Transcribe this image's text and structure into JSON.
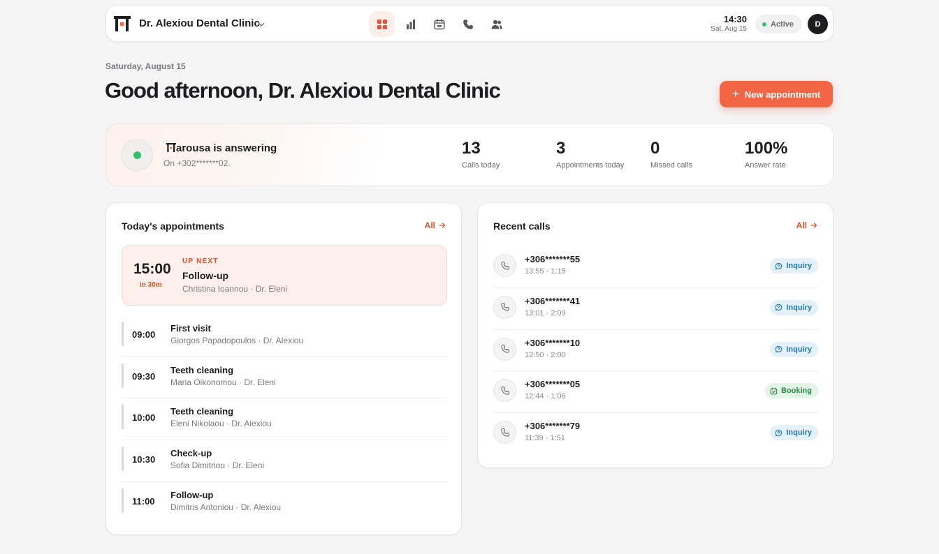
{
  "header": {
    "clinic_name": "Dr. Alexiou Dental Clinic",
    "nav": [
      {
        "name": "dashboard-icon",
        "active": true
      },
      {
        "name": "analytics-icon",
        "active": false
      },
      {
        "name": "calendar-icon",
        "active": false
      },
      {
        "name": "phone-icon",
        "active": false
      },
      {
        "name": "contacts-icon",
        "active": false
      }
    ],
    "time": "14:30",
    "date": "Sat, Aug 15",
    "status": "Active",
    "avatar_initial": "D"
  },
  "page": {
    "date_label": "Saturday, August 15",
    "greeting": "Good afternoon, Dr. Alexiou Dental Clinic",
    "new_appointment_label": "New appointment"
  },
  "assistant": {
    "name_suffix": "arousa is answering",
    "subtitle": "On +302*******02."
  },
  "stats": [
    {
      "value": "13",
      "label": "Calls today"
    },
    {
      "value": "3",
      "label": "Appointments today"
    },
    {
      "value": "0",
      "label": "Missed calls"
    },
    {
      "value": "100%",
      "label": "Answer rate"
    }
  ],
  "appointments": {
    "title": "Today's appointments",
    "all_label": "All",
    "next": {
      "time": "15:00",
      "in": "in 30m",
      "badge": "UP NEXT",
      "title": "Follow-up",
      "subtitle": "Christina Ioannou · Dr. Eleni"
    },
    "items": [
      {
        "time": "09:00",
        "title": "First visit",
        "subtitle": "Giorgos Papadopoulos · Dr. Alexiou"
      },
      {
        "time": "09:30",
        "title": "Teeth cleaning",
        "subtitle": "Maria Oikonomou · Dr. Eleni"
      },
      {
        "time": "10:00",
        "title": "Teeth cleaning",
        "subtitle": "Eleni Nikolaou · Dr. Alexiou"
      },
      {
        "time": "10:30",
        "title": "Check-up",
        "subtitle": "Sofia Dimitriou · Dr. Eleni"
      },
      {
        "time": "11:00",
        "title": "Follow-up",
        "subtitle": "Dimitris Antoniou · Dr. Alexiou"
      }
    ]
  },
  "calls": {
    "title": "Recent calls",
    "all_label": "All",
    "items": [
      {
        "number": "+306*******55",
        "meta": "13:55 · 1:15",
        "tag": "Inquiry",
        "kind": "inquiry"
      },
      {
        "number": "+306*******41",
        "meta": "13:01 · 2:09",
        "tag": "Inquiry",
        "kind": "inquiry"
      },
      {
        "number": "+306*******10",
        "meta": "12:50 · 2:00",
        "tag": "Inquiry",
        "kind": "inquiry"
      },
      {
        "number": "+306*******05",
        "meta": "12:44 · 1:06",
        "tag": "Booking",
        "kind": "booking"
      },
      {
        "number": "+306*******79",
        "meta": "11:39 · 1:51",
        "tag": "Inquiry",
        "kind": "inquiry"
      }
    ]
  },
  "colors": {
    "accent": "#f26545",
    "accent_text": "#d9532f",
    "success": "#2ec46b",
    "inquiry": "#2276b5",
    "booking": "#2a8a44"
  }
}
